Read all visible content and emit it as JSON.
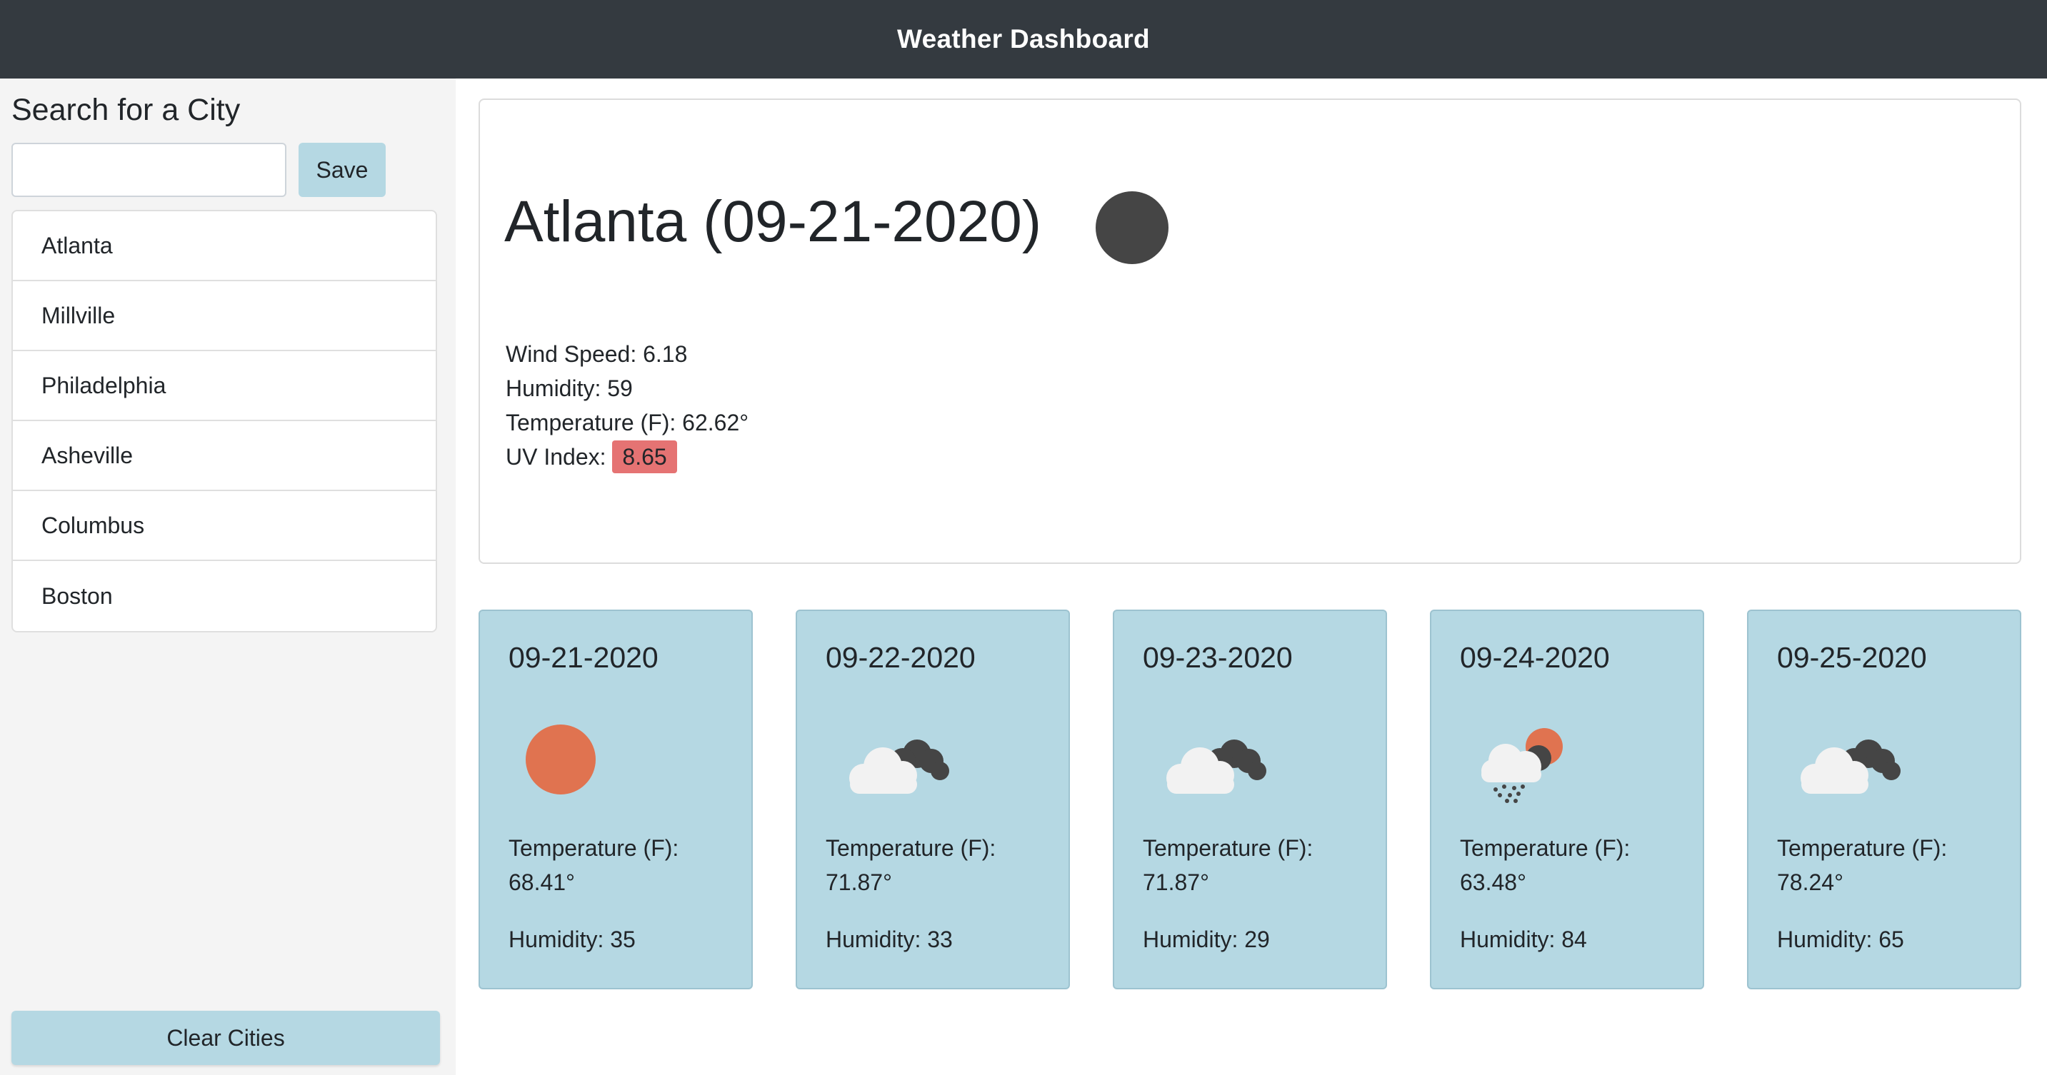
{
  "header": {
    "title": "Weather Dashboard"
  },
  "sidebar": {
    "heading": "Search for a City",
    "search": {
      "value": "",
      "placeholder": ""
    },
    "save_label": "Save",
    "cities": [
      "Atlanta",
      "Millville",
      "Philadelphia",
      "Asheville",
      "Columbus",
      "Boston"
    ],
    "clear_label": "Clear Cities"
  },
  "current": {
    "title": "Atlanta (09-21-2020)",
    "icon": "moon-icon",
    "wind_label": "Wind Speed:",
    "wind_value": "6.18",
    "humidity_label": "Humidity:",
    "humidity_value": "59",
    "temperature_label": "Temperature (F):",
    "temperature_value": "62.62°",
    "uv_label": "UV Index:",
    "uv_value": "8.65",
    "uv_color": "#e57373"
  },
  "forecast": [
    {
      "date": "09-21-2020",
      "icon": "sun-icon",
      "temp_label": "Temperature (F):",
      "temp": "68.41°",
      "humidity": "Humidity: 35"
    },
    {
      "date": "09-22-2020",
      "icon": "cloudy-icon",
      "temp_label": "Temperature (F):",
      "temp": "71.87°",
      "humidity": "Humidity: 33"
    },
    {
      "date": "09-23-2020",
      "icon": "cloudy-icon",
      "temp_label": "Temperature (F):",
      "temp": "71.87°",
      "humidity": "Humidity: 29"
    },
    {
      "date": "09-24-2020",
      "icon": "rain-sun-icon",
      "temp_label": "Temperature (F):",
      "temp": "63.48°",
      "humidity": "Humidity: 84"
    },
    {
      "date": "09-25-2020",
      "icon": "cloudy-icon",
      "temp_label": "Temperature (F):",
      "temp": "78.24°",
      "humidity": "Humidity: 65"
    }
  ],
  "colors": {
    "header_bg": "#343a40",
    "card_bg": "#b5d8e3",
    "sun": "#e07350",
    "cloud_dark": "#454545",
    "cloud_light": "#f2f2f2"
  }
}
